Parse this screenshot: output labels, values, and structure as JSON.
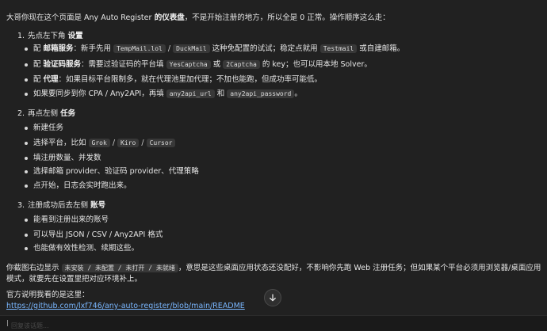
{
  "intro": {
    "p1": "大哥你现在这个页面是 ",
    "app_name": "Any Auto Register",
    "bold": " 的仪表盘",
    "p2": "，不是开始注册的地方，所以全是 0 正常。操作顺序这么走："
  },
  "steps": [
    {
      "num": "1.",
      "text": "先点左下角 ",
      "bold": "设置",
      "bullets": [
        {
          "prefix": "配 ",
          "bold": "邮箱服务",
          "mid": "：新手先用 ",
          "code1": "TempMail.lol",
          "sep1": " / ",
          "code2": "DuckMail",
          "mid2": " 这种免配置的试试；稳定点就用 ",
          "code3": "Testmail",
          "suffix": " 或自建邮箱。"
        },
        {
          "prefix": "配 ",
          "bold": "验证码服务",
          "mid": "：需要过验证码的平台填 ",
          "code1": "YesCaptcha",
          "sep1": " 或 ",
          "code2": "2Captcha",
          "suffix": " 的 key；也可以用本地 Solver。"
        },
        {
          "prefix": "配 ",
          "bold": "代理",
          "suffix": "：如果目标平台限制多，就在代理池里加代理；不加也能跑，但成功率可能低。"
        },
        {
          "prefix": "如果要同步到你 CPA / Any2API，再填 ",
          "code1": "any2api_url",
          "sep1": " 和 ",
          "code2": "any2api_password",
          "suffix": "。"
        }
      ]
    },
    {
      "num": "2.",
      "text": "再点左侧 ",
      "bold": "任务",
      "bullets": [
        {
          "text": "新建任务"
        },
        {
          "prefix": "选择平台，比如 ",
          "code1": "Grok",
          "sep1": " / ",
          "code2": "Kiro",
          "sep2": " / ",
          "code3": "Cursor"
        },
        {
          "text": "填注册数量、并发数"
        },
        {
          "text": "选择邮箱 provider、验证码 provider、代理策略"
        },
        {
          "text": "点开始，日志会实时跑出来。"
        }
      ]
    },
    {
      "num": "3.",
      "text": "注册成功后去左侧 ",
      "bold": "账号",
      "bullets": [
        {
          "text": "能看到注册出来的账号"
        },
        {
          "text": "可以导出 JSON / CSV / Any2API 格式"
        },
        {
          "text": "也能做有效性检测、续期这些。"
        }
      ]
    }
  ],
  "note": {
    "prefix": "你截图右边显示 ",
    "code": "未安装 / 未配置 / 未打开 / 未就绪",
    "suffix": "，意思是这些桌面应用状态还没配好，不影响你先跑 Web 注册任务；但如果某个平台必须用浏览器/桌面应用模式，就要先在设置里把对应环境补上。"
  },
  "source": {
    "label": "官方说明我看的是这里：",
    "url": "https://github.com/lxf746/any-auto-register/blob/main/README"
  },
  "composer": {
    "placeholder": "回复该话题..."
  },
  "icons": {
    "scroll_down": "arrow-down-icon"
  }
}
